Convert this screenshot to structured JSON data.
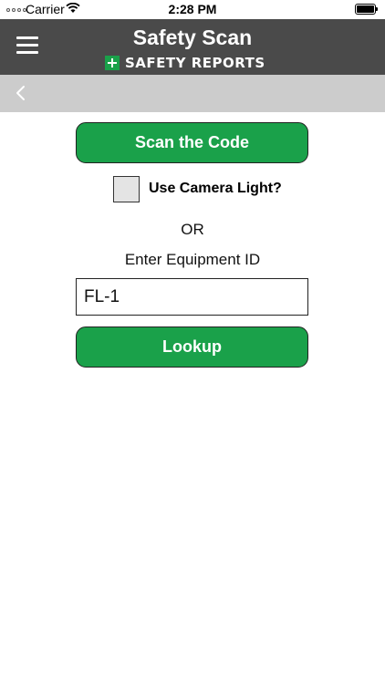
{
  "status_bar": {
    "carrier": "Carrier",
    "time": "2:28 PM"
  },
  "header": {
    "title": "Safety Scan",
    "logo_text": "SAFETY REPORTS",
    "logo_color": "#1aa14a",
    "background": "#4a4a4a"
  },
  "nav": {
    "back_icon": "chevron-left-icon",
    "background": "#cccccc"
  },
  "main": {
    "scan_button": "Scan the Code",
    "camera_light_label": "Use Camera Light?",
    "camera_light_checked": false,
    "or_label": "OR",
    "enter_id_label": "Enter Equipment ID",
    "equipment_id_value": "FL-1",
    "lookup_button": "Lookup",
    "button_color": "#1aa14a"
  }
}
